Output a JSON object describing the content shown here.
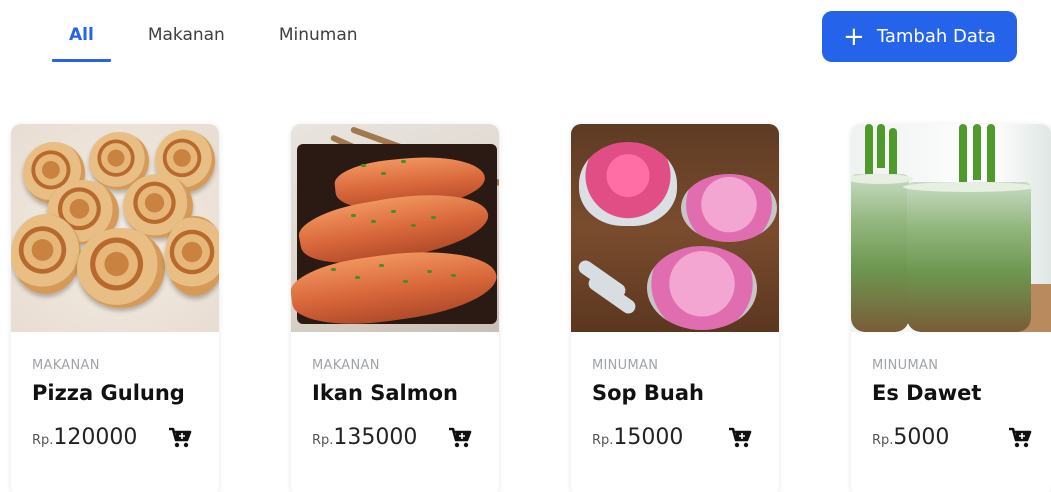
{
  "tabs": [
    {
      "label": "All",
      "active": true
    },
    {
      "label": "Makanan",
      "active": false
    },
    {
      "label": "Minuman",
      "active": false
    }
  ],
  "add_button": {
    "label": "Tambah Data",
    "icon": "plus-icon"
  },
  "colors": {
    "accent": "#2563eb"
  },
  "products": [
    {
      "category": "MAKANAN",
      "name": "Pizza Gulung",
      "currency": "Rp.",
      "price": "120000",
      "image": "pizza-rolls-image"
    },
    {
      "category": "MAKANAN",
      "name": "Ikan Salmon",
      "currency": "Rp.",
      "price": "135000",
      "image": "salmon-fillet-image"
    },
    {
      "category": "MINUMAN",
      "name": "Sop Buah",
      "currency": "Rp.",
      "price": "15000",
      "image": "fruit-soup-image"
    },
    {
      "category": "MINUMAN",
      "name": "Es Dawet",
      "currency": "Rp.",
      "price": "5000",
      "image": "es-dawet-image"
    }
  ]
}
